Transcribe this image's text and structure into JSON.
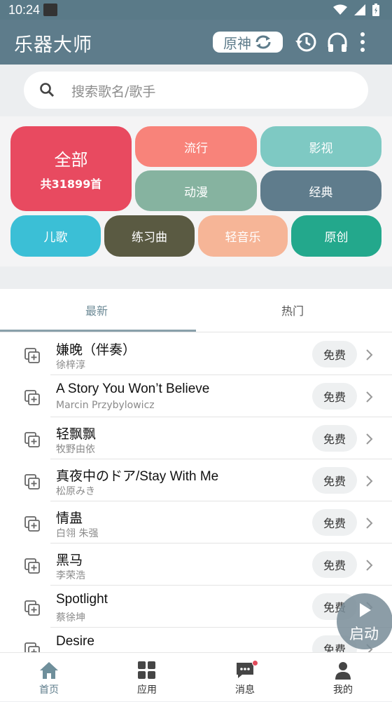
{
  "status": {
    "time": "10:24"
  },
  "app": {
    "title": "乐器大师",
    "chip_label": "原神"
  },
  "search": {
    "placeholder": "搜索歌名/歌手"
  },
  "categories": {
    "all": {
      "label": "全部",
      "count": "共31899首",
      "color": "#e84a60"
    },
    "items": [
      {
        "label": "流行",
        "color": "#f8837a"
      },
      {
        "label": "影视",
        "color": "#7ec9c3"
      },
      {
        "label": "动漫",
        "color": "#86b3a0"
      },
      {
        "label": "经典",
        "color": "#5f7c8c"
      },
      {
        "label": "儿歌",
        "color": "#3bbfd6"
      },
      {
        "label": "练习曲",
        "color": "#5a5a42"
      },
      {
        "label": "轻音乐",
        "color": "#f6b597"
      },
      {
        "label": "原创",
        "color": "#23a88c"
      }
    ]
  },
  "tabs": [
    {
      "label": "最新"
    },
    {
      "label": "热门"
    }
  ],
  "songs": [
    {
      "title": "嫌晚（伴奏）",
      "artist": "徐梓淳",
      "badge": "免费"
    },
    {
      "title": "A Story You Won’t Believe",
      "artist": "Marcin Przybylowicz",
      "badge": "免费"
    },
    {
      "title": "轻飘飘",
      "artist": "牧野由依",
      "badge": "免费"
    },
    {
      "title": "真夜中のドア/Stay With Me",
      "artist": "松原みき",
      "badge": "免费"
    },
    {
      "title": "情蛊",
      "artist": "白翎 朱强",
      "badge": "免费"
    },
    {
      "title": "黑马",
      "artist": "李荣浩",
      "badge": "免费"
    },
    {
      "title": "Spotlight",
      "artist": "蔡徐坤",
      "badge": "免费"
    },
    {
      "title": "Desire",
      "artist": "",
      "badge": "免费"
    }
  ],
  "fab": {
    "label": "启动"
  },
  "nav": [
    {
      "label": "首页",
      "icon": "home-icon"
    },
    {
      "label": "应用",
      "icon": "apps-icon"
    },
    {
      "label": "消息",
      "icon": "message-icon"
    },
    {
      "label": "我的",
      "icon": "profile-icon"
    }
  ]
}
